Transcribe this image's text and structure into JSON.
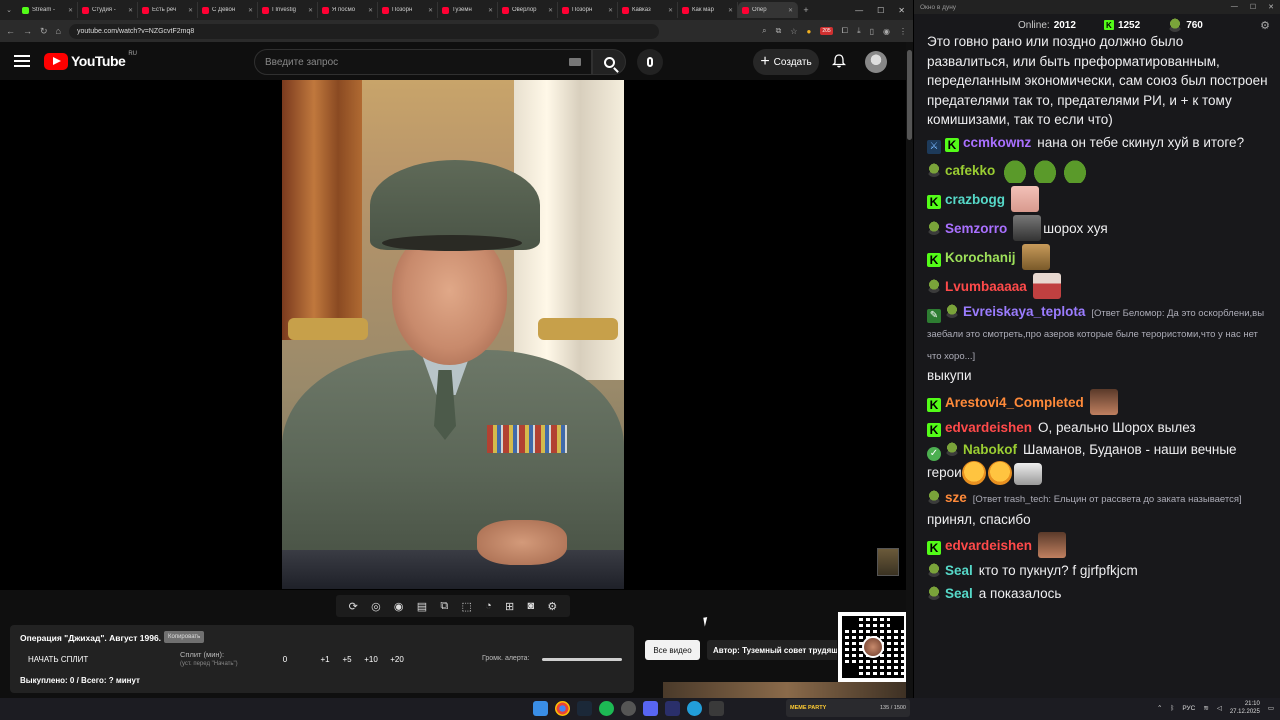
{
  "browser": {
    "tabs": [
      {
        "label": "Stream -",
        "color": "#53fc18"
      },
      {
        "label": "Студия -",
        "color": "#ff0033"
      },
      {
        "label": "Есть реч",
        "color": "#ff0033"
      },
      {
        "label": "С Девон",
        "color": "#ff0033"
      },
      {
        "label": "I Investig",
        "color": "#ff0033"
      },
      {
        "label": "Я посмо",
        "color": "#ff0033"
      },
      {
        "label": "Позорн",
        "color": "#ff0033"
      },
      {
        "label": "Туземн",
        "color": "#ff0033"
      },
      {
        "label": "Оверлор",
        "color": "#ff0033"
      },
      {
        "label": "Позорн",
        "color": "#ff0033"
      },
      {
        "label": "Кавказ",
        "color": "#ff0033"
      },
      {
        "label": "Как мар",
        "color": "#ff0033"
      },
      {
        "label": "Опер",
        "color": "#ff0033",
        "active": true
      }
    ],
    "url": "youtube.com/watch?v=NZGcvtF2mq8",
    "extension_badge": "205"
  },
  "youtube": {
    "logo_text": "YouTube",
    "region": "RU",
    "search_placeholder": "Введите запрос",
    "create_label": "Создать"
  },
  "split_panel": {
    "title": "Операция \"Джихад\". Август 1996.",
    "copy_label": "Копировать",
    "start_label": "НАЧАТЬ СПЛИТ",
    "split_label": "Сплит (мин):",
    "split_hint": "(уст. перед \"Начать\")",
    "values": [
      "0",
      "+1",
      "+5",
      "+10",
      "+20"
    ],
    "volume_label": "Громк. алерта:",
    "bought_text": "Выкуплено: 0 / Всего: ? минут"
  },
  "all_videos_label": "Все видео",
  "author_label": "Автор: Туземный совет трудящ",
  "chat": {
    "window_title": "Окно в дуну",
    "online_label": "Online:",
    "online_count": "2012",
    "kick_count": "1252",
    "pepe_count": "760",
    "top_text": "Это говно рано или поздно должно было развалиться, или быть преформатированным, переделанным экономически, сам союз был построен предателями так то, предателями РИ, и + к тому комишизами, так то если что)",
    "messages": [
      {
        "user": "ccmkownz",
        "color": "c-purple",
        "badges": [
          "sword",
          "kick"
        ],
        "text": "нана он тебе скинул хуй в итоге?"
      },
      {
        "user": "cafekko",
        "color": "c-olive",
        "badges": [
          "pepe"
        ],
        "emotes": [
          "frog",
          "frog",
          "frog"
        ],
        "text": ""
      },
      {
        "user": "crazbogg",
        "color": "c-teal",
        "badges": [
          "kick"
        ],
        "emotes": [
          "pink"
        ],
        "text": ""
      },
      {
        "user": "Semzorro",
        "color": "c-purple",
        "badges": [
          "pepe"
        ],
        "emotes": [
          "gray"
        ],
        "text": "шорох хуя"
      },
      {
        "user": "Korochanij",
        "color": "c-lime",
        "badges": [
          "kick"
        ],
        "emotes": [
          "cat"
        ],
        "text": ""
      },
      {
        "user": "Lvumbaaaaa",
        "color": "c-red",
        "badges": [
          "pepe"
        ],
        "emotes": [
          "man"
        ],
        "text": ""
      },
      {
        "user": "Evreiskaya_teplota",
        "color": "c-violet",
        "badges": [
          "pen",
          "pepe"
        ],
        "reply": "[Ответ Беломор: Да это оскорблени,вы заебали это смотреть,про азеров которые быле терористоми,что у нас нет что хоро...]",
        "text": "выкупи"
      },
      {
        "user": "Arestovi4_Completed",
        "color": "c-orange",
        "badges": [
          "kick"
        ],
        "emotes": [
          "hat"
        ],
        "text": ""
      },
      {
        "user": "edvardeishen",
        "color": "c-red",
        "badges": [
          "kick"
        ],
        "text": "О, реально Шорох вылез"
      },
      {
        "user": "Nabokof",
        "color": "c-olive",
        "badges": [
          "ok",
          "pepe"
        ],
        "text": "Шаманов, Буданов - наши вечные герои",
        "emotes_after": [
          "blush",
          "blush",
          "gun"
        ]
      },
      {
        "user": "sze",
        "color": "c-orange",
        "badges": [
          "pepe"
        ],
        "reply": "[Ответ trash_tech: Ельцин от рассвета до заката называется]",
        "text": "принял, спасибо"
      },
      {
        "user": "edvardeishen",
        "color": "c-red",
        "badges": [
          "kick"
        ],
        "emotes": [
          "hat"
        ],
        "text": ""
      },
      {
        "user": "Seal",
        "color": "c-teal",
        "badges": [
          "pepe"
        ],
        "text": "кто то пукнул? f gjrfpfkjcm"
      },
      {
        "user": "Seal",
        "color": "c-teal",
        "badges": [
          "pepe"
        ],
        "text": "а показалось"
      }
    ]
  },
  "taskbar": {
    "meme_label": "MEME PARTY",
    "meme_count": "135 / 1500",
    "lang": "РУС",
    "time": "21:10",
    "date": "27.12.2025"
  }
}
